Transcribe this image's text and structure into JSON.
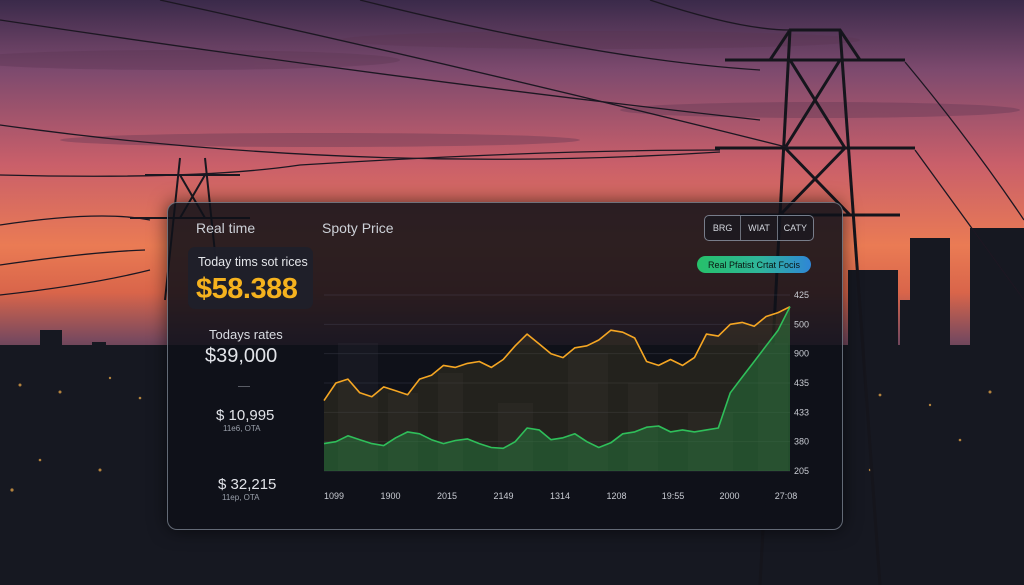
{
  "panel": {
    "title": "Real time",
    "chart_title": "Spoty Price",
    "range_buttons": [
      "BRG",
      "WIAT",
      "CATY"
    ],
    "badge": "Real Pfatist Crtat Focis",
    "spot_card": {
      "label": "Today tims sot rices",
      "value": "$58.388"
    },
    "todays_rates": {
      "label": "Todays rates",
      "value": "$39,000"
    },
    "stats": [
      {
        "value": "$ 10,995",
        "sub": "11e6, OTA"
      },
      {
        "value": "$ 32,215",
        "sub": "11ep, OTA"
      }
    ]
  },
  "colors": {
    "accent_orange": "#f5a623",
    "series_green": "#2fbf5a",
    "badge_start": "#26c06a",
    "badge_end": "#2f86d6"
  },
  "chart_data": {
    "type": "line",
    "x_labels": [
      "1099",
      "1900",
      "2015",
      "2149",
      "1314",
      "1208",
      "19:55",
      "2000",
      "27:08"
    ],
    "y_labels": [
      "425",
      "500",
      "900",
      "435",
      "433",
      "380",
      "205"
    ],
    "series": [
      {
        "values": [
          180,
          225,
          235,
          200,
          190,
          215,
          205,
          195,
          235,
          245,
          270,
          265,
          275,
          280,
          265,
          285,
          320,
          350,
          325,
          300,
          290,
          315,
          320,
          335,
          360,
          355,
          340,
          280,
          270,
          285,
          270,
          290,
          350,
          345,
          375,
          380,
          370,
          395,
          405,
          420
        ]
      },
      {
        "values": [
          70,
          75,
          90,
          80,
          70,
          65,
          85,
          100,
          95,
          80,
          70,
          78,
          82,
          70,
          60,
          58,
          75,
          110,
          105,
          80,
          85,
          95,
          75,
          60,
          72,
          95,
          100,
          112,
          115,
          100,
          105,
          100,
          105,
          110,
          200,
          240,
          280,
          320,
          360,
          420
        ]
      }
    ],
    "ylim": [
      0,
      450
    ],
    "grid": true
  }
}
